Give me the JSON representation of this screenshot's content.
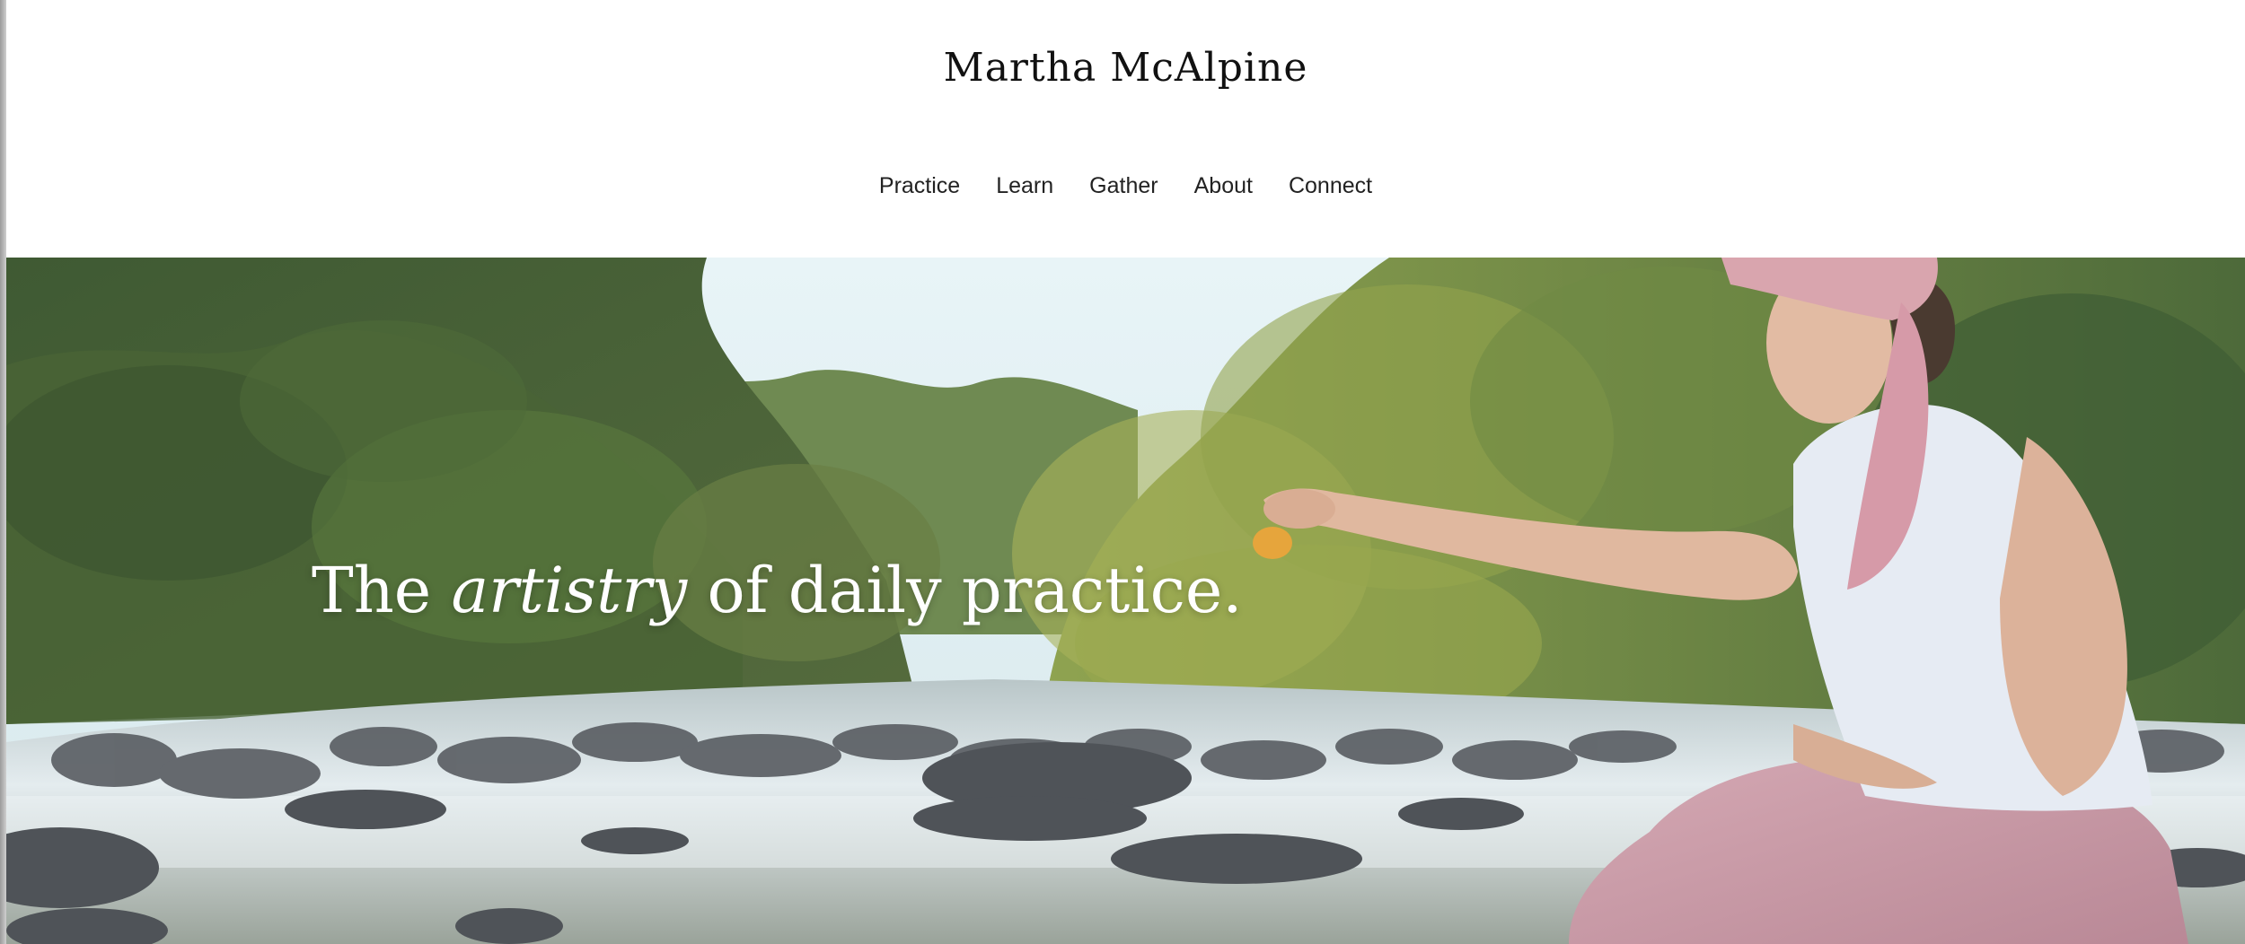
{
  "site": {
    "title": "Martha McAlpine"
  },
  "nav": {
    "items": [
      {
        "label": "Practice"
      },
      {
        "label": "Learn"
      },
      {
        "label": "Gather"
      },
      {
        "label": "About"
      },
      {
        "label": "Connect"
      }
    ]
  },
  "hero": {
    "headline_start": "The ",
    "headline_emphasis": "artistry",
    "headline_end": " of daily practice."
  },
  "colors": {
    "text": "#111111",
    "hero_text": "#ffffff",
    "sky": "#e3f0f3",
    "foliage": "#5d7340",
    "water": "#dfe9ef",
    "tank_top": "#e8edf5",
    "pink": "#d8a9b5"
  }
}
